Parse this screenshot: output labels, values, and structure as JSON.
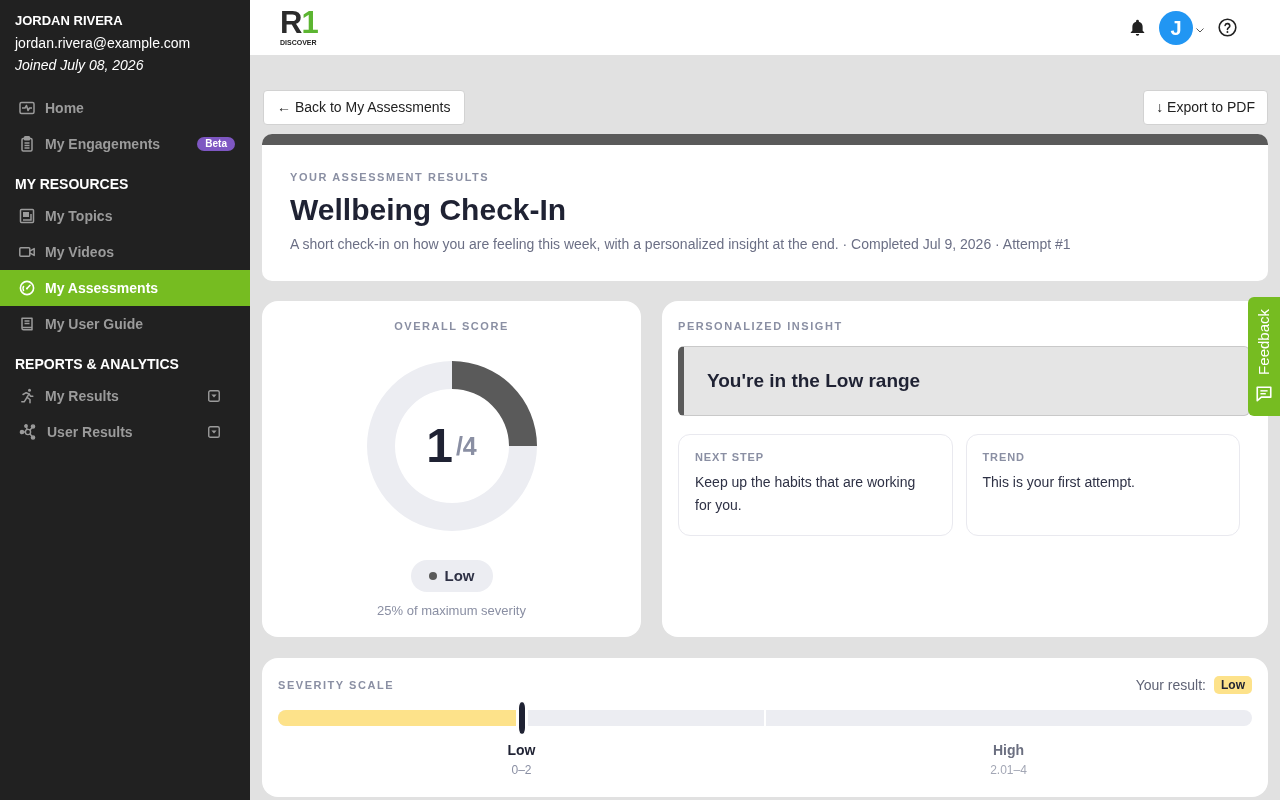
{
  "sidebar": {
    "user": {
      "name": "JORDAN RIVERA",
      "email": "jordan.rivera@example.com",
      "joined": "Joined July 08, 2026"
    },
    "sections": [
      {
        "items": [
          {
            "label": "Home",
            "kind": "link",
            "selected": false
          },
          {
            "label": "My Engagements",
            "kind": "link",
            "selected": false,
            "badge": "Beta"
          }
        ]
      },
      {
        "heading": "MY RESOURCES",
        "items": [
          {
            "label": "My Topics",
            "kind": "link",
            "selected": false
          },
          {
            "label": "My Videos",
            "kind": "link",
            "selected": false
          },
          {
            "label": "My Assessments",
            "kind": "link",
            "selected": true
          },
          {
            "label": "My User Guide",
            "kind": "link",
            "selected": false
          }
        ]
      },
      {
        "heading": "REPORTS & ANALYTICS",
        "items": [
          {
            "label": "My Results",
            "kind": "group",
            "selected": false
          },
          {
            "label": "User Results",
            "kind": "group",
            "selected": false
          }
        ]
      }
    ]
  },
  "header": {
    "logo": {
      "mark": "R",
      "accent": "1",
      "caption": "DISCOVER"
    },
    "avatar_initial": "J"
  },
  "toolbar": {
    "back": "← Back to My Assessments",
    "export": "↓ Export to PDF"
  },
  "results_header": {
    "eyebrow": "YOUR ASSESSMENT RESULTS",
    "title": "Wellbeing Check-In",
    "subtitle": "A short check-in on how you are feeling this week, with a personalized insight at the end. · Completed Jul 9, 2026 · Attempt #1"
  },
  "score": {
    "label": "OVERALL SCORE",
    "value": "1",
    "out_of": "/4",
    "chart_data": {
      "type": "donut",
      "values": [
        25,
        75
      ]
    },
    "severity": "Low",
    "caption": "25% of maximum severity"
  },
  "insight": {
    "label": "PERSONALIZED INSIGHT",
    "headline": "You're in the Low range",
    "cards": [
      {
        "label": "NEXT STEP",
        "text": "Keep up the habits that are working for you."
      },
      {
        "label": "TREND",
        "text": "This is your first attempt."
      }
    ]
  },
  "severity_scale": {
    "label": "SEVERITY SCALE",
    "result_label": "Your result:",
    "result": "Low",
    "level": 0.25,
    "bands": [
      {
        "label": "Low",
        "range": "0–2",
        "selected": true
      },
      {
        "label": "High",
        "range": "2.01–4",
        "selected": false
      }
    ]
  },
  "feedback_tab": {
    "label": "Feedback"
  }
}
